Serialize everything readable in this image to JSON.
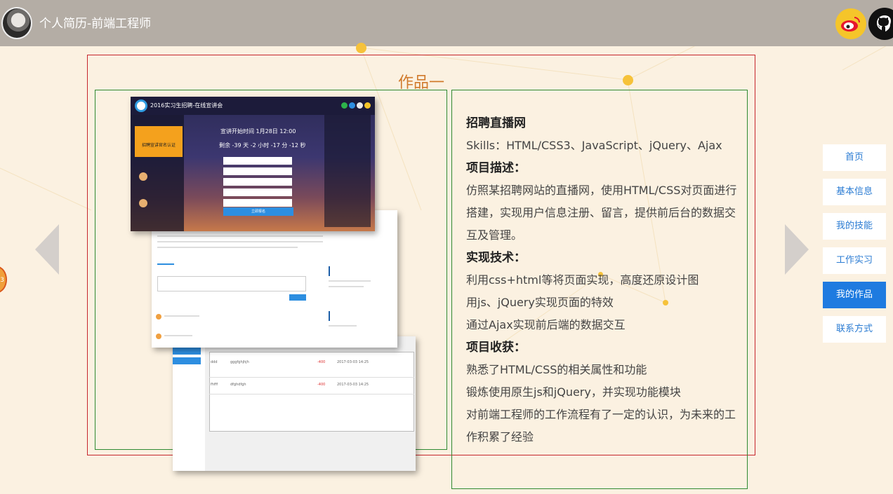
{
  "header": {
    "title": "个人简历-前端工程师",
    "avatar": "avatar-photo",
    "social": [
      {
        "name": "weibo-icon",
        "color": "#f5c52a"
      },
      {
        "name": "github-icon",
        "color": "#111111"
      }
    ]
  },
  "section": {
    "title": "作品一"
  },
  "project": {
    "name": "招聘直播网",
    "skills": "Skills：HTML/CSS3、JavaScript、jQuery、Ajax",
    "desc_heading": "项目描述：",
    "desc_text": "仿照某招聘网站的直播网，使用HTML/CSS对页面进行搭建，实现用户信息注册、留言，提供前后台的数据交互及管理。",
    "tech_heading": "实现技术：",
    "tech_items": [
      "利用css+html等将页面实现，高度还原设计图",
      "用js、jQuery实现页面的特效",
      "通过Ajax实现前后端的数据交互"
    ],
    "gain_heading": "项目收获：",
    "gain_items": [
      "熟悉了HTML/CSS的相关属性和功能",
      "锻炼使用原生js和jQuery，并实现功能模块",
      "对前端工程师的工作流程有了一定的认识，为未来的工作积累了经验"
    ]
  },
  "screenshot": {
    "title": "2016实习生招聘-在线宣讲会",
    "countdown_title": "宣讲开始时间   1月28日   12:00",
    "countdown": "剩余 -39 天 -2 小时 -17 分 -12 秒",
    "badge": "招聘宣讲官名认证",
    "submit": "立即报名",
    "row1_a": "ddd",
    "row1_b": "gggfghjhjh",
    "row1_c": "-400",
    "row1_d": "2017-03-03 14:25",
    "row2_a": "fhfff",
    "row2_b": "dfghdfgh",
    "row2_c": "-400",
    "row2_d": "2017-03-03 14:25"
  },
  "nav": {
    "items": [
      "首页",
      "基本信息",
      "我的技能",
      "工作实习",
      "我的作品",
      "联系方式"
    ],
    "active_index": 4
  },
  "colors": {
    "accent": "#1e7be0",
    "title_orange": "#d07a2c",
    "header_bg": "#b4ada5",
    "page_bg": "#fbf1e1",
    "outer_border": "#c6262c",
    "inner_border": "#2f8a32"
  }
}
